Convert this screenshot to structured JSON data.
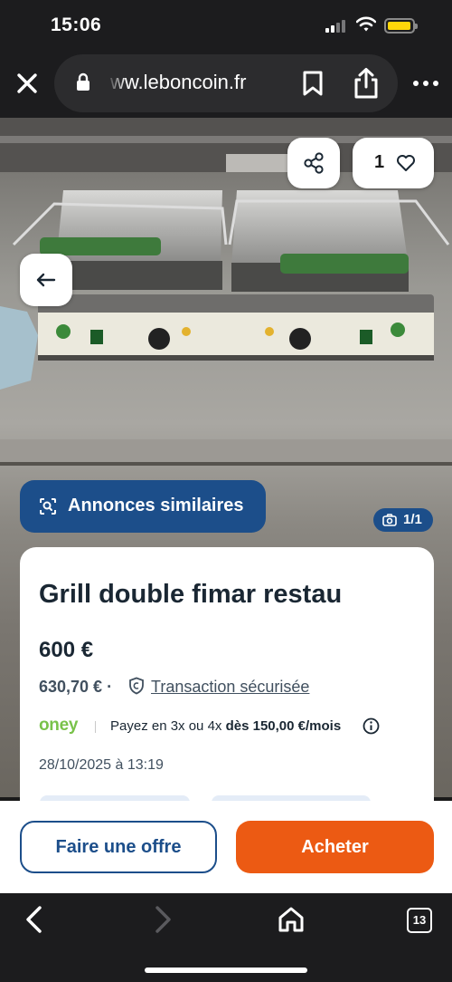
{
  "status_bar": {
    "time": "15:06"
  },
  "browser": {
    "url": "ww.leboncoin.fr",
    "tab_count": "13"
  },
  "listing": {
    "favorites_count": "1",
    "similar_label": "Annonces similaires",
    "photo_count": "1/1",
    "title": "Grill double fimar restau",
    "price": "600 €",
    "price_with_fees": "630,70 € ·",
    "secure_label": "Transaction sécurisée",
    "oney_brand": "oney",
    "oney_prefix": "Payez en 3x ou 4x ",
    "oney_amount": "dès 150,00 €/mois",
    "date": "28/10/2025 à 13:19"
  },
  "actions": {
    "offer_label": "Faire une offre",
    "buy_label": "Acheter"
  },
  "icons": [
    "close-icon",
    "lock-icon",
    "bookmark-icon",
    "share-icon",
    "more-icon",
    "back-arrow-icon",
    "heart-icon",
    "similar-icon",
    "camera-icon",
    "shield-icon",
    "info-icon",
    "home-icon",
    "tabs-icon"
  ],
  "colors": {
    "brand_blue": "#1c4e8a",
    "buy_orange": "#ec5a13",
    "oney_green": "#79c24a"
  }
}
